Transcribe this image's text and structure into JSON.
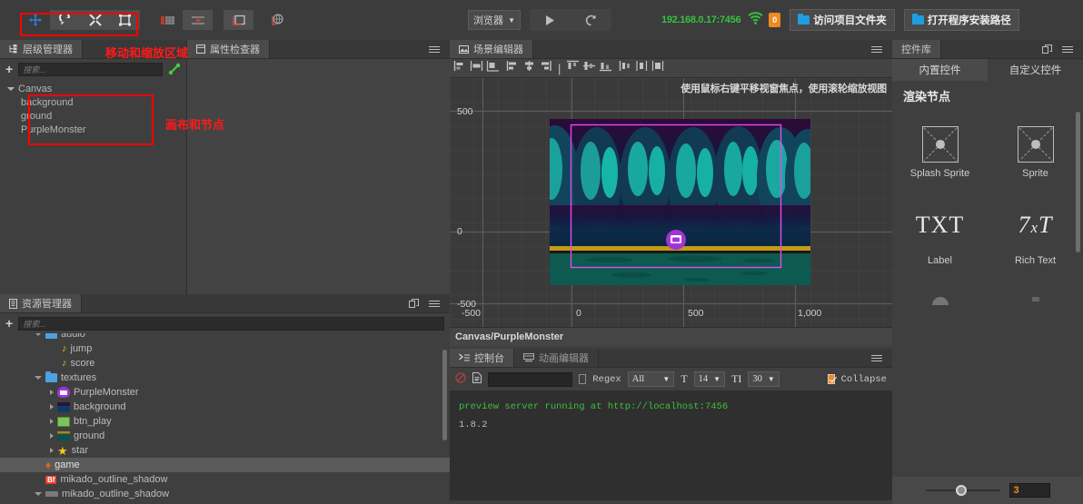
{
  "toolbar": {
    "tools": [
      {
        "name": "move-tool",
        "glyph": "move",
        "active": true
      },
      {
        "name": "rotate-tool",
        "glyph": "rotate",
        "active": false
      },
      {
        "name": "scale-tool",
        "glyph": "scale",
        "active": false
      },
      {
        "name": "rect-transform-tool",
        "glyph": "rect",
        "active": false
      },
      {
        "name": "grid-tool",
        "glyph": "grid",
        "active": false
      },
      {
        "name": "snap-tool",
        "glyph": "snap",
        "active": false
      },
      {
        "name": "pivot-tool",
        "glyph": "pivot",
        "active": false
      },
      {
        "name": "global-tool",
        "glyph": "global",
        "active": false
      }
    ]
  },
  "annotations": {
    "move_zoom_area": "移动和缩放区域",
    "canvas_and_nodes": "画布和节点"
  },
  "hierarchy": {
    "tab_label": "层级管理器",
    "search_placeholder": "搜索...",
    "add_label": "+",
    "nodes": [
      {
        "label": "Canvas",
        "depth": 0,
        "expanded": true
      },
      {
        "label": "background",
        "depth": 1
      },
      {
        "label": "ground",
        "depth": 1
      },
      {
        "label": "PurpleMonster",
        "depth": 1
      }
    ]
  },
  "property_inspector": {
    "tab_label": "属性检查器"
  },
  "assets": {
    "tab_label": "资源管理器",
    "search_placeholder": "搜索...",
    "items": [
      {
        "label": "audio",
        "depth": 1,
        "icon": "folder-icon",
        "expanded": true,
        "clipped": true
      },
      {
        "label": "jump",
        "depth": 2,
        "icon": "audio-note-icon"
      },
      {
        "label": "score",
        "depth": 2,
        "icon": "audio-note-icon"
      },
      {
        "label": "textures",
        "depth": 1,
        "icon": "folder-icon",
        "expanded": true
      },
      {
        "label": "PurpleMonster",
        "depth": 2,
        "icon": "texture-icon",
        "color": "#a333d6",
        "collapsed": true
      },
      {
        "label": "background",
        "depth": 2,
        "icon": "texture-icon",
        "color": "#16324e",
        "collapsed": true
      },
      {
        "label": "btn_play",
        "depth": 2,
        "icon": "texture-icon",
        "color": "#7cc45a",
        "collapsed": true
      },
      {
        "label": "ground",
        "depth": 2,
        "icon": "texture-icon",
        "color": "#0d5149",
        "collapsed": true
      },
      {
        "label": "star",
        "depth": 2,
        "icon": "texture-icon",
        "color": "#f5c518",
        "collapsed": true
      },
      {
        "label": "game",
        "depth": 1,
        "icon": "fire-icon",
        "selected": true
      },
      {
        "label": "mikado_outline_shadow",
        "depth": 1,
        "icon": "font-bf-icon"
      },
      {
        "label": "mikado_outline_shadow",
        "depth": 0,
        "icon": "font-file-icon",
        "expanded": true
      }
    ]
  },
  "topbar": {
    "browser_select": "浏览器",
    "play_button": "play-icon",
    "reload_button": "reload-icon",
    "ip_address": "192.168.0.17:7456",
    "wifi_icon": "wifi-icon",
    "error_count": "0",
    "open_project_folder": "访问项目文件夹",
    "open_install_path": "打开程序安装路径"
  },
  "scene": {
    "tab_label": "场景编辑器",
    "hint": "使用鼠标右键平移视窗焦点，使用滚轮缩放视图",
    "status_path": "Canvas/PurpleMonster",
    "axis": {
      "x_ticks": [
        "-500",
        "0",
        "500",
        "1,000"
      ],
      "y_ticks": [
        "500",
        "0",
        "-500"
      ]
    },
    "align_tools": [
      "align-left",
      "align-center-h",
      "align-right",
      "dist-left",
      "dist-center",
      "dist-right",
      "align-top",
      "align-middle",
      "align-bottom",
      "dist-top",
      "dist-middle",
      "dist-bottom"
    ]
  },
  "console": {
    "tabs": [
      {
        "label": "控制台",
        "icon": "console-icon",
        "active": true
      },
      {
        "label": "动画编辑器",
        "icon": "animation-icon",
        "active": false
      }
    ],
    "clear_icon": "clear-icon",
    "copy_icon": "copy-icon",
    "filter_value": "",
    "regex_label": "Regex",
    "level_filter": "All",
    "font_size": "14",
    "line_height": "30",
    "collapse_label": "Collapse",
    "collapse_checked": true,
    "log_lines": [
      {
        "text": "preview server running at http://localhost:7456",
        "color": "#3fbf3f"
      },
      {
        "text": "1.8.2",
        "color": "#b9b9b9"
      }
    ]
  },
  "widgets": {
    "tab_label": "控件库",
    "subtabs": [
      {
        "label": "内置控件",
        "active": true
      },
      {
        "label": "自定义控件",
        "active": false
      }
    ],
    "section_title": "渲染节点",
    "items": [
      {
        "label": "Splash Sprite",
        "icon": "sprite-icon"
      },
      {
        "label": "Sprite",
        "icon": "sprite-icon"
      },
      {
        "label": "Label",
        "icon": "txt-glyph"
      },
      {
        "label": "Rich Text",
        "icon": "rich-txt-glyph"
      }
    ],
    "zoom_value": "3"
  },
  "colors": {
    "accent_orange": "#f08a1e",
    "ok_green": "#35c23d",
    "annotation_red": "#ff1a1a",
    "selection_magenta": "#e04cf0",
    "panel_bg": "#3f3f3f"
  }
}
